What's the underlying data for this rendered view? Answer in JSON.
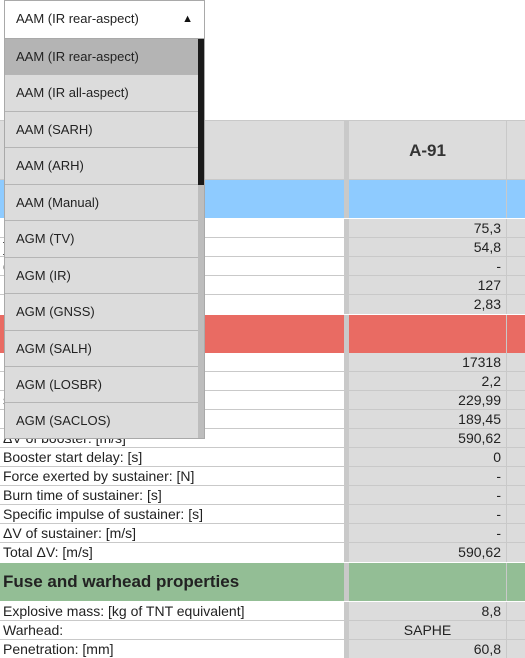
{
  "dropdown": {
    "selected": "AAM (IR rear-aspect)",
    "options": [
      "AAM (IR rear-aspect)",
      "AAM (IR all-aspect)",
      "AAM (SARH)",
      "AAM (ARH)",
      "AAM (Manual)",
      "AGM (TV)",
      "AGM (IR)",
      "AGM (GNSS)",
      "AGM (SALH)",
      "AGM (LOSBR)",
      "AGM (SACLOS)"
    ]
  },
  "table": {
    "header": {
      "label": "",
      "column": "A-91"
    },
    "section_blue": {
      "label": ""
    },
    "blue_rows": [
      {
        "label": "",
        "value": "75,3"
      },
      {
        "label": "]",
        "value": "54,8"
      },
      {
        "label": "g]",
        "value": "-"
      },
      {
        "label": "",
        "value": "127"
      },
      {
        "label": "",
        "value": "2,83"
      }
    ],
    "section_red": {
      "label": ""
    },
    "red_rows": [
      {
        "label": "",
        "value": "17318"
      },
      {
        "label": "",
        "value": "2,2"
      },
      {
        "label": "s²]",
        "value": "229,99"
      },
      {
        "label": "",
        "value": "189,45"
      },
      {
        "label": "ΔV of booster: [m/s]",
        "value": "590,62"
      },
      {
        "label": "Booster start delay: [s]",
        "value": "0"
      },
      {
        "label": "Force exerted by sustainer: [N]",
        "value": "-"
      },
      {
        "label": "Burn time of sustainer: [s]",
        "value": "-"
      },
      {
        "label": "Specific impulse of sustainer: [s]",
        "value": "-"
      },
      {
        "label": "ΔV of sustainer: [m/s]",
        "value": "-"
      },
      {
        "label": "Total ΔV: [m/s]",
        "value": "590,62"
      }
    ],
    "section_green": {
      "label": "Fuse and warhead properties"
    },
    "green_rows": [
      {
        "label": "Explosive mass: [kg of TNT equivalent]",
        "value": "8,8"
      },
      {
        "label": "Warhead:",
        "value": "SAPHE"
      },
      {
        "label": "Penetration: [mm]",
        "value": "60,8"
      }
    ]
  }
}
